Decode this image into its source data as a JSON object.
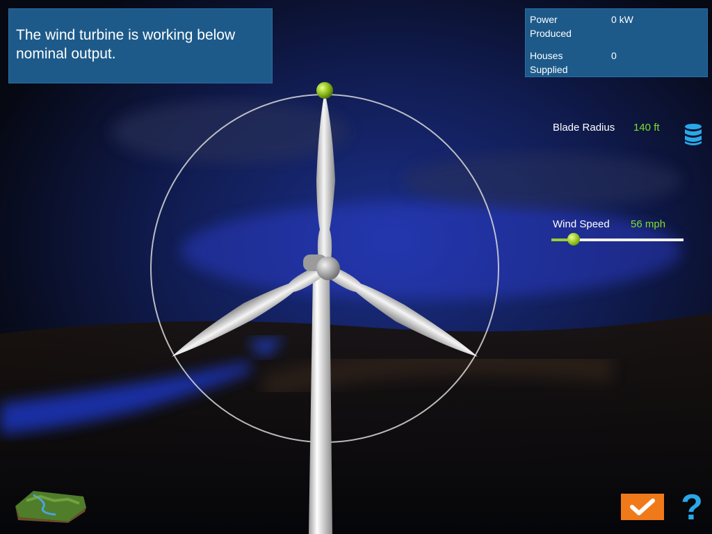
{
  "status": {
    "message": "The wind turbine is working below nominal output."
  },
  "stats": {
    "power_label": "Power Produced",
    "power_value": "0 kW",
    "houses_label": "Houses Supplied",
    "houses_value": "0"
  },
  "controls": {
    "blade_radius_label": "Blade Radius",
    "blade_radius_value": "140 ft",
    "wind_speed_label": "Wind Speed",
    "wind_speed_value": "56 mph",
    "wind_speed_fraction": 0.17
  },
  "icons": {
    "blade_radius": "database-stack-icon",
    "map": "terrain-map-icon",
    "confirm": "checkmark-icon",
    "help": "question-mark-icon",
    "rotor_handle": "green-handle-icon"
  },
  "buttons": {
    "help_label": "?"
  },
  "colors": {
    "panel": "#1d5a8a",
    "accent_green": "#7be02d",
    "confirm_orange": "#f07a1a",
    "help_blue": "#29a8e8"
  }
}
